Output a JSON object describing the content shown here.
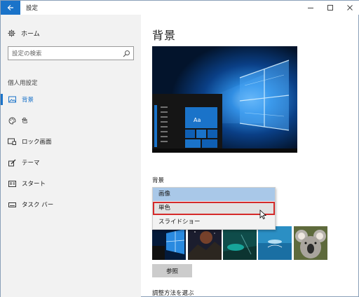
{
  "window": {
    "title": "設定",
    "back_icon": "back-arrow-icon",
    "minimize_icon": "minimize-icon",
    "maximize_icon": "maximize-icon",
    "close_icon": "close-icon"
  },
  "sidebar": {
    "home_label": "ホーム",
    "home_icon": "gear-icon",
    "search_placeholder": "設定の検索",
    "section_title": "個人用設定",
    "items": [
      {
        "label": "背景",
        "icon": "picture-icon",
        "active": true
      },
      {
        "label": "色",
        "icon": "palette-icon",
        "active": false
      },
      {
        "label": "ロック画面",
        "icon": "lock-screen-icon",
        "active": false
      },
      {
        "label": "テーマ",
        "icon": "brush-icon",
        "active": false
      },
      {
        "label": "スタート",
        "icon": "start-icon",
        "active": false
      },
      {
        "label": "タスク バー",
        "icon": "taskbar-icon",
        "active": false
      }
    ]
  },
  "main": {
    "title": "背景",
    "preview_tile_text": "Aa",
    "background_label": "背景",
    "dropdown_options": [
      "画像",
      "単色",
      "スライドショー"
    ],
    "dropdown_selected": "画像",
    "dropdown_hover": "単色",
    "browse_label": "参照",
    "fit_label": "調整方法を選ぶ"
  },
  "colors": {
    "accent": "#1a73c9",
    "sidebar_bg": "#f2f2f2",
    "dropdown_selected": "#a9c8e8",
    "highlight_box": "#d52a2a"
  }
}
